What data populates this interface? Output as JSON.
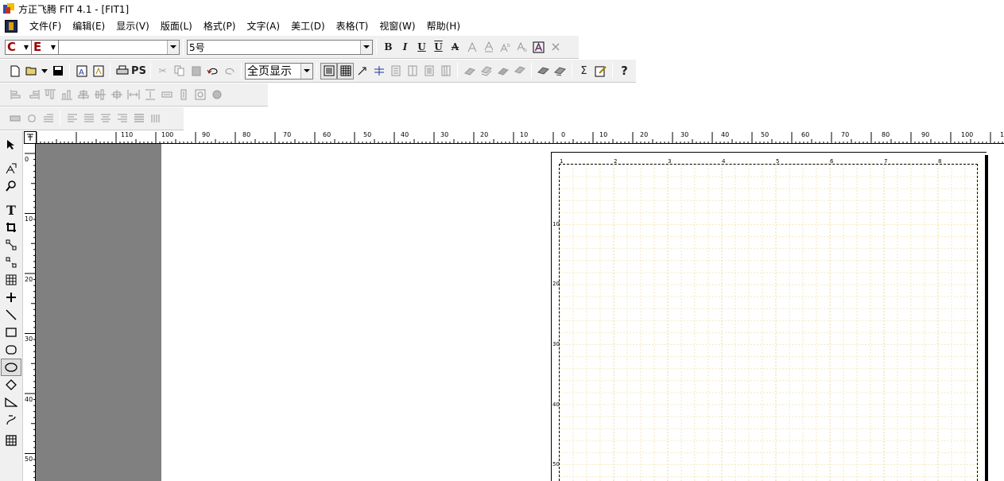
{
  "window": {
    "title": "方正飞腾 FIT 4.1 - [FIT1]"
  },
  "menu": [
    "文件(F)",
    "编辑(E)",
    "显示(V)",
    "版面(L)",
    "格式(P)",
    "文字(A)",
    "美工(D)",
    "表格(T)",
    "视窗(W)",
    "帮助(H)"
  ],
  "text_toolbar": {
    "c_lang": "C",
    "e_lang": "E",
    "font_name": "",
    "font_size": "5号",
    "bold": "B",
    "italic": "I",
    "underline": "U",
    "overline": "U",
    "strike": "A"
  },
  "main_toolbar": {
    "ps_label": "PS",
    "zoom": "全页显示",
    "help": "?"
  },
  "rulers": {
    "h_labels": [
      "110",
      "100",
      "90",
      "80",
      "70",
      "60",
      "50",
      "40",
      "30",
      "20",
      "10",
      "0",
      "10",
      "20",
      "30",
      "40",
      "50",
      "60",
      "70",
      "80",
      "90",
      "100",
      "1"
    ],
    "v_labels": [
      "0",
      "10",
      "20",
      "30",
      "40",
      "50"
    ]
  },
  "page": {
    "column_labels": [
      "1",
      "2",
      "3",
      "4",
      "5",
      "6",
      "7",
      "8"
    ],
    "row_labels": [
      "10",
      "20",
      "30",
      "40",
      "50"
    ]
  },
  "colors": {
    "window_bg": "#ffffff",
    "toolbar_bg": "#f0f0f0",
    "pasteboard_grey": "#808080",
    "grid_line": "#f2eac0"
  }
}
